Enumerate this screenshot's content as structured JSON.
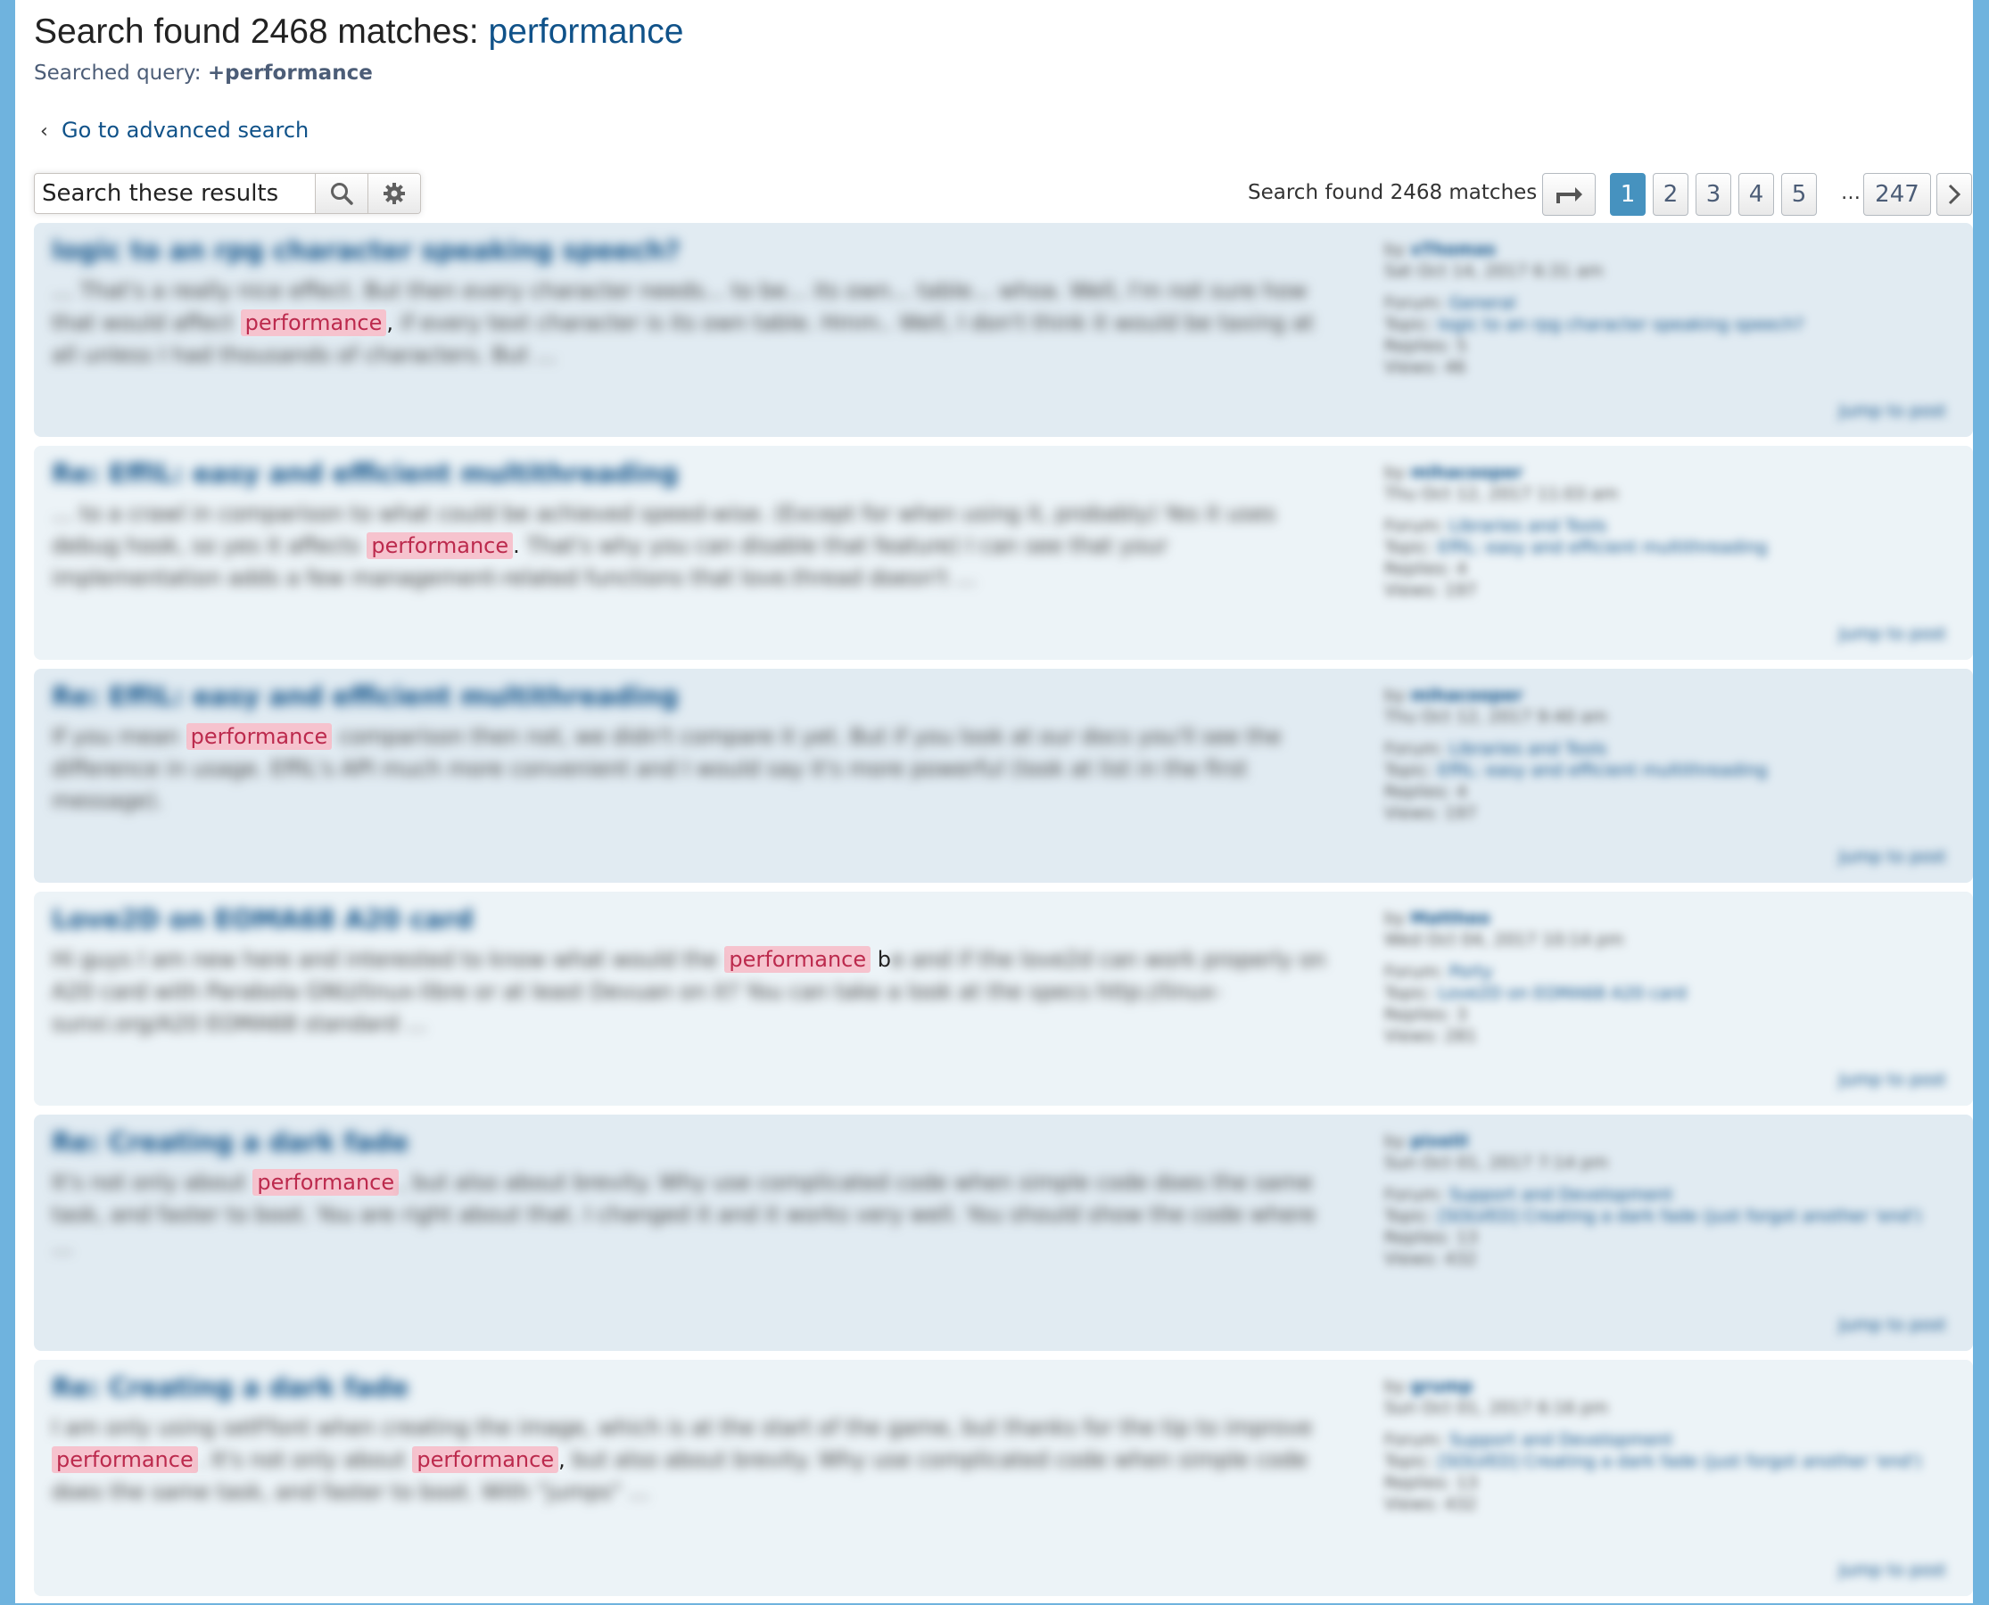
{
  "header": {
    "title_prefix": "Search found 2468 matches: ",
    "title_keyword": "performance",
    "query_label": "Searched query: ",
    "query_value": "+performance",
    "advanced_link": "Go to advanced search"
  },
  "search": {
    "placeholder": "Search these results",
    "search_icon": "search-icon",
    "settings_icon": "gear-icon"
  },
  "pagination": {
    "found_text": "Search found 2468 matches",
    "jump_icon": "arrow-right-icon",
    "pages": [
      "1",
      "2",
      "3",
      "4",
      "5"
    ],
    "ellipsis": "…",
    "last_page": "247",
    "next_icon": "chevron-right-icon",
    "active_page": "1"
  },
  "colors": {
    "highlight_bg": "#f6c3ce",
    "highlight_text": "#bc2a4d",
    "link": "#105289",
    "active_page": "#4692bf",
    "side_border": "#6fb3de"
  },
  "results": [
    {
      "title": "logic to an rpg character speaking speech?",
      "parts": [
        {
          "t": "… That's a really nice effect. But then every character needs... to be... its own... table... whoa. Well, I'm not sure how that would affect ",
          "k": "b"
        },
        {
          "t": "performance",
          "k": "h"
        },
        {
          "t": ",",
          "k": "s"
        },
        {
          "t": " if every text character is its own table. Hmm.. Well, I don't think it would be taxing at all unless I had thousands of characters. But …",
          "k": "b"
        }
      ],
      "meta": {
        "by": "by",
        "author": "xThomas",
        "date": "Sat Oct 14, 2017 6:31 am",
        "forum_label": "Forum:",
        "forum": "General",
        "topic_label": "Topic:",
        "topic": "logic to an rpg character speaking speech?",
        "replies_label": "Replies:",
        "replies": "5",
        "views_label": "Views:",
        "views": "46"
      },
      "jump": "Jump to post"
    },
    {
      "title": "Re: EffIL: easy and efficient multithreading",
      "parts": [
        {
          "t": "… to a crawl in comparison to what could be achieved speed-wise. (Except for when using it, probably) Yes it uses debug hook, so yes it affects ",
          "k": "b"
        },
        {
          "t": "performance",
          "k": "h"
        },
        {
          "t": ".",
          "k": "s"
        },
        {
          "t": " That's why you can disable that feature) I can see that your implementation adds a few management-related functions that love.thread doesn't …",
          "k": "b"
        }
      ],
      "meta": {
        "by": "by",
        "author": "mihacooper",
        "date": "Thu Oct 12, 2017 11:03 am",
        "forum_label": "Forum:",
        "forum": "Libraries and Tools",
        "topic_label": "Topic:",
        "topic": "EffIL: easy and efficient multithreading",
        "replies_label": "Replies:",
        "replies": "4",
        "views_label": "Views:",
        "views": "197"
      },
      "jump": "Jump to post"
    },
    {
      "title": "Re: EffIL: easy and efficient multithreading",
      "parts": [
        {
          "t": "If you mean ",
          "k": "b"
        },
        {
          "t": "performance",
          "k": "h"
        },
        {
          "t": " comparison then not, we didn't compare it yet. But if you look at our docs you'll see the difference in usage. EffIL's API much more convenient and I would say it's more powerful (look at list in the first message).",
          "k": "b"
        }
      ],
      "meta": {
        "by": "by",
        "author": "mihacooper",
        "date": "Thu Oct 12, 2017 9:40 am",
        "forum_label": "Forum:",
        "forum": "Libraries and Tools",
        "topic_label": "Topic:",
        "topic": "EffIL: easy and efficient multithreading",
        "replies_label": "Replies:",
        "replies": "4",
        "views_label": "Views:",
        "views": "197"
      },
      "jump": "Jump to post"
    },
    {
      "title": "Love2D on EOMA68 A20 card",
      "parts": [
        {
          "t": "Hi guys I am new here and interested to know what would the ",
          "k": "b"
        },
        {
          "t": "performance",
          "k": "h"
        },
        {
          "t": " b",
          "k": "s"
        },
        {
          "t": "e and if the love2d can work properly on A20 card with Parabola GNU/linux-libre or at least Devuan on it? You can take a look at the specs http://linux-sunxi.org/A20 EOMA68 standard …",
          "k": "b"
        }
      ],
      "meta": {
        "by": "by",
        "author": "Mattheo",
        "date": "Wed Oct 04, 2017 10:14 pm",
        "forum_label": "Forum:",
        "forum": "Porty",
        "topic_label": "Topic:",
        "topic": "Love2D on EOMA68 A20 card",
        "replies_label": "Replies:",
        "replies": "3",
        "views_label": "Views:",
        "views": "281"
      },
      "jump": "Jump to post"
    },
    {
      "title": "Re: Creating a dark fade",
      "parts": [
        {
          "t": "It's not only about ",
          "k": "b"
        },
        {
          "t": "performance",
          "k": "h"
        },
        {
          "t": ", but also about brevity. Why use complicated code when simple code does the same task, and faster to boot. You are right about that. I changed it and it works very well. You should show the code where …",
          "k": "b"
        }
      ],
      "meta": {
        "by": "by",
        "author": "pixelil",
        "date": "Sun Oct 01, 2017 7:14 pm",
        "forum_label": "Forum:",
        "forum": "Support and Development",
        "topic_label": "Topic:",
        "topic": "[SOLVED] Creating a dark fade (just forgot another 'end')",
        "replies_label": "Replies:",
        "replies": "13",
        "views_label": "Views:",
        "views": "432"
      },
      "jump": "Jump to post"
    },
    {
      "title": "Re: Creating a dark fade",
      "parts": [
        {
          "t": "I am only using setFfont when creating the image, which is at the start of the game, but thanks for the tip to improve ",
          "k": "b"
        },
        {
          "t": "performance",
          "k": "h"
        },
        {
          "t": ". It's not only about ",
          "k": "b"
        },
        {
          "t": "performance",
          "k": "h"
        },
        {
          "t": ",",
          "k": "s"
        },
        {
          "t": " but also about brevity. Why use complicated code when simple code does the same task, and faster to boot. With \"jumps\" …",
          "k": "b"
        }
      ],
      "meta": {
        "by": "by",
        "author": "grump",
        "date": "Sun Oct 01, 2017 6:16 pm",
        "forum_label": "Forum:",
        "forum": "Support and Development",
        "topic_label": "Topic:",
        "topic": "[SOLVED] Creating a dark fade (just forgot another 'end')",
        "replies_label": "Replies:",
        "replies": "13",
        "views_label": "Views:",
        "views": "432"
      },
      "jump": "Jump to post"
    }
  ]
}
